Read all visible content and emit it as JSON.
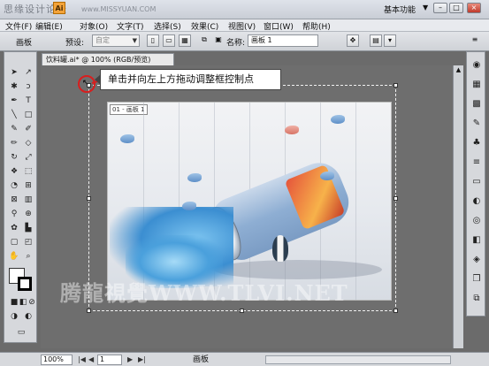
{
  "app": {
    "watermark_top": "思缘设计论坛",
    "logo_text": "Ai",
    "watermark_url": "www.MISSYUAN.COM",
    "workspace": "基本功能",
    "window_buttons": [
      "–",
      "□",
      "×"
    ]
  },
  "menu": [
    "文件(F)",
    "编辑(E)",
    "对象(O)",
    "文字(T)",
    "选择(S)",
    "效果(C)",
    "视图(V)",
    "窗口(W)",
    "帮助(H)"
  ],
  "controlbar": {
    "title": "画板",
    "preset_label": "预设:",
    "preset_value": "自定",
    "name_label": "名称:",
    "name_value": "画板 1"
  },
  "document": {
    "tab": "饮料罐.ai* @ 100% (RGB/预览)",
    "tab_close": "×",
    "artboard_label": "01 - 画板 1"
  },
  "callout": {
    "text": "单击并向左上方拖动调整框控制点"
  },
  "photo_watermark": "腾龍視覺WWW.TLVI.NET",
  "statusbar": {
    "zoom": "100%",
    "nav_first": "|◀",
    "nav_prev": "◀",
    "page": "1",
    "nav_next": "▶",
    "nav_last": "▶|",
    "artboard": "画板"
  }
}
